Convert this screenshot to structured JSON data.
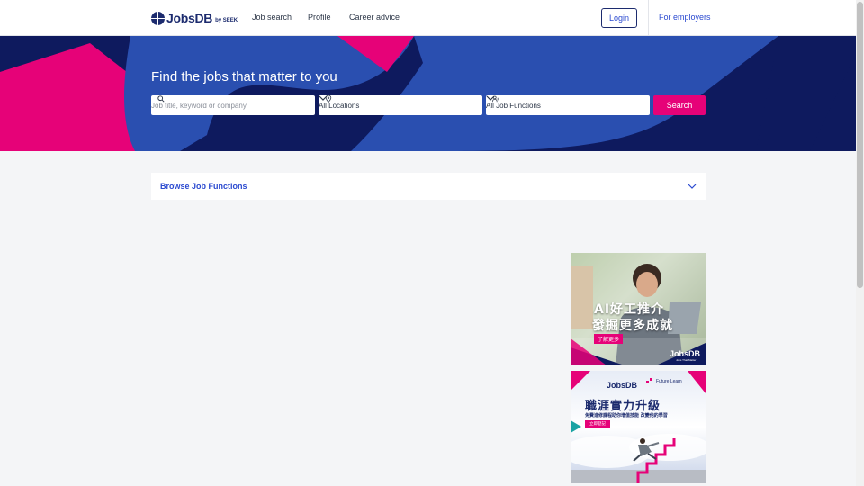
{
  "header": {
    "logo_text": "JobsDB",
    "logo_sub": "by SEEK",
    "nav": {
      "job_search": "Job search",
      "profile": "Profile",
      "career_advice": "Career advice"
    },
    "login_label": "Login",
    "employers_label": "For employers"
  },
  "hero": {
    "title": "Find the jobs that matter to you",
    "keyword_placeholder": "Job title, keyword or company",
    "location_value": "All Locations",
    "function_value": "All Job Functions",
    "search_label": "Search"
  },
  "browse": {
    "label": "Browse Job Functions"
  },
  "ads": {
    "ad1": {
      "headline_1": "AI好工推介",
      "headline_2": "發掘更多成就",
      "cta": "了解更多",
      "brand": "JobsDB",
      "tagline": "Jobs That Matter"
    },
    "ad2": {
      "brand": "JobsDB",
      "partner": "Future Learn",
      "headline": "職涯實力升級",
      "subtitle": "免費進修課程助你增值技能 改變他的學習",
      "cta": "立即登記"
    }
  },
  "colors": {
    "brand_navy": "#0e1a5e",
    "brand_pink": "#e60278",
    "link_blue": "#2b4ad0"
  }
}
